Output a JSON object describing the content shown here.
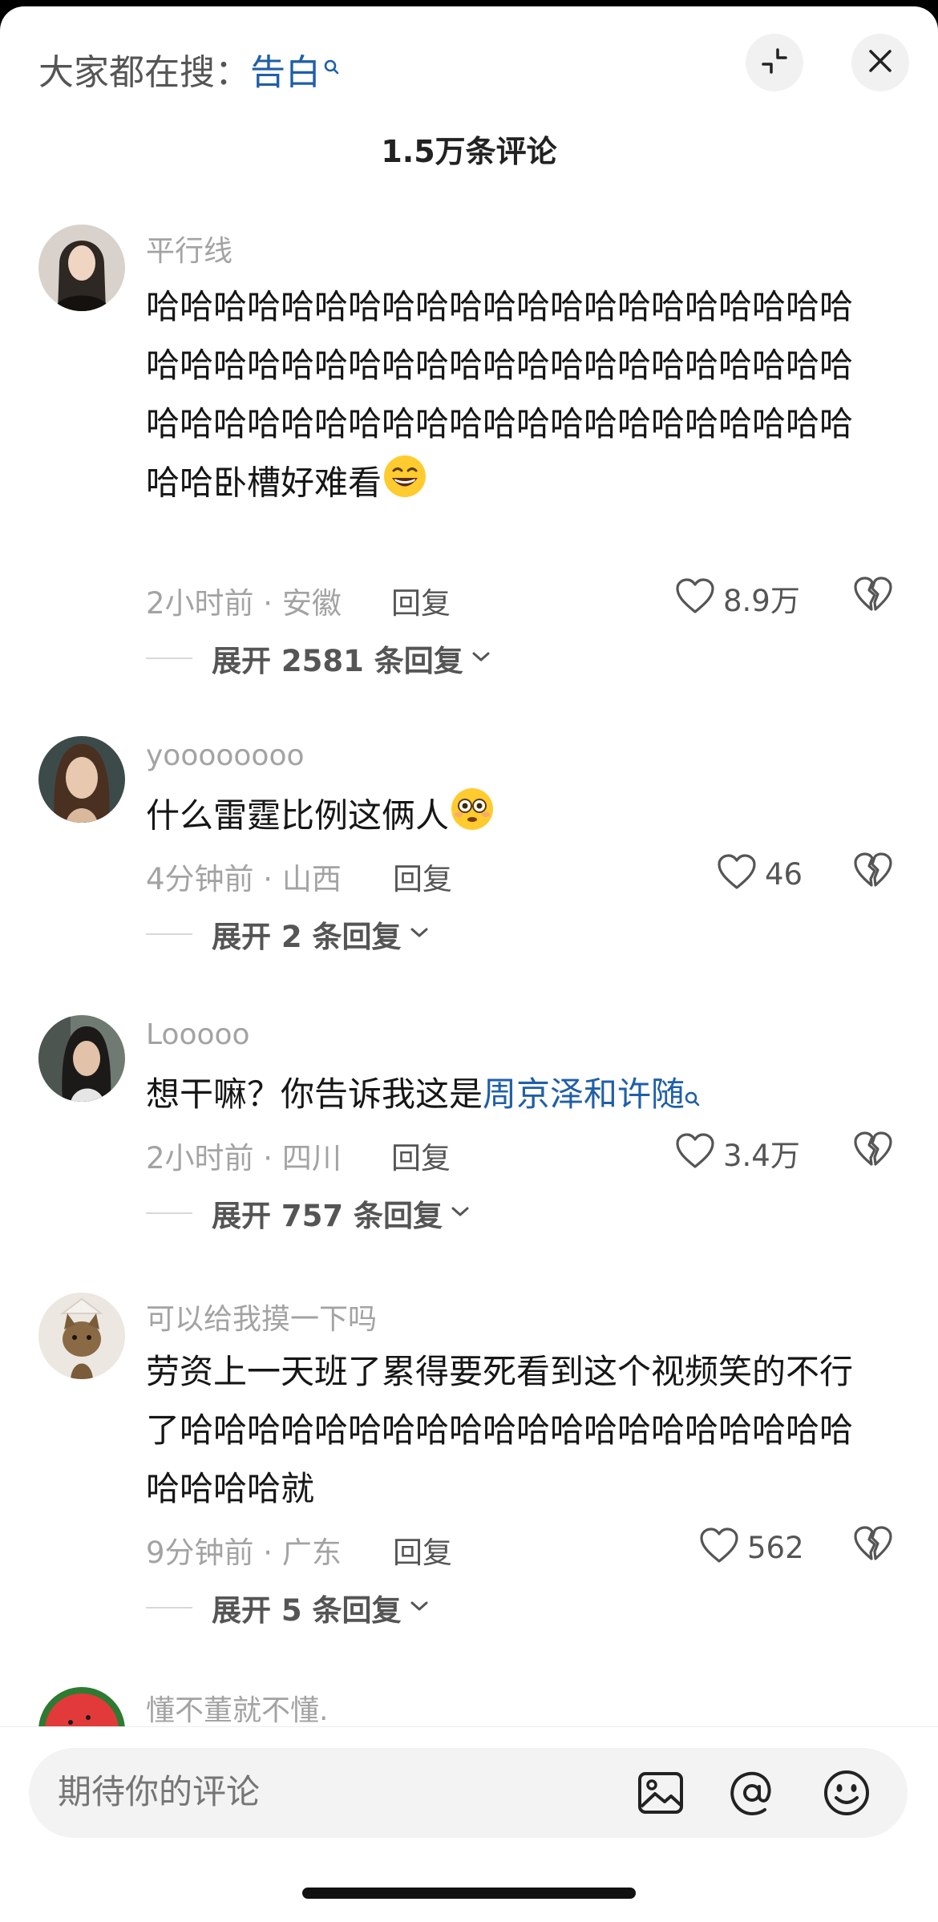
{
  "header": {
    "search_prefix": "大家都在搜：",
    "search_keyword": "告白",
    "comment_count": "1.5万条评论",
    "collapse_icon": "collapse-icon",
    "close_icon": "close-icon"
  },
  "comments": [
    {
      "username": "平行线",
      "text": "哈哈哈哈哈哈哈哈哈哈哈哈哈哈哈哈哈哈哈哈哈哈哈哈哈哈哈哈哈哈哈哈哈哈哈哈哈哈哈哈哈哈哈哈哈哈哈哈哈哈哈哈哈哈哈哈哈哈哈哈哈哈哈哈哈卧槽好难看",
      "time_location": "2小时前 · 安徽",
      "reply_label": "回复",
      "likes": "8.9万",
      "expand": "展开 2581 条回复"
    },
    {
      "username": "yoooooooo",
      "text": "什么雷霆比例这俩人",
      "time_location": "4分钟前 · 山西",
      "reply_label": "回复",
      "likes": "46",
      "expand": "展开 2 条回复"
    },
    {
      "username": "Looooo",
      "text": "想干嘛？你告诉我这是",
      "mention": "周京泽和许随",
      "time_location": "2小时前 · 四川",
      "reply_label": "回复",
      "likes": "3.4万",
      "expand": "展开 757 条回复"
    },
    {
      "username": "可以给我摸一下吗",
      "text": "劳资上一天班了累得要死看到这个视频笑的不行了哈哈哈哈哈哈哈哈哈哈哈哈哈哈哈哈哈哈哈哈哈哈哈哈就",
      "time_location": "9分钟前 · 广东",
      "reply_label": "回复",
      "likes": "562",
      "expand": "展开 5 条回复"
    },
    {
      "username": "懂不董就不懂."
    }
  ],
  "composer": {
    "placeholder": "期待你的评论",
    "image_icon": "image-icon",
    "mention_icon": "at-icon",
    "emoji_icon": "emoji-icon"
  },
  "colors": {
    "link": "#1f5fa8",
    "meta": "#a3a3a3",
    "text": "#161616"
  }
}
